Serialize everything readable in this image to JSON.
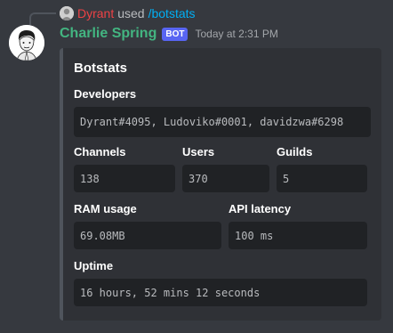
{
  "interaction": {
    "user": "Dyrant",
    "used_word": "used",
    "command": "/botstats"
  },
  "message": {
    "author": "Charlie Spring",
    "badge": "BOT",
    "timestamp": "Today at 2:31 PM"
  },
  "embed": {
    "title": "Botstats",
    "developers": {
      "label": "Developers",
      "value": "Dyrant#4095, Ludoviko#0001, davidzwa#6298"
    },
    "channels": {
      "label": "Channels",
      "value": "138"
    },
    "users": {
      "label": "Users",
      "value": "370"
    },
    "guilds": {
      "label": "Guilds",
      "value": "5"
    },
    "ram": {
      "label": "RAM usage",
      "value": "69.08MB"
    },
    "latency": {
      "label": "API latency",
      "value": "100 ms"
    },
    "uptime": {
      "label": "Uptime",
      "value": "16 hours, 52 mins 12 seconds"
    }
  },
  "colors": {
    "background": "#36393f",
    "embed_background": "#2f3136",
    "code_background": "#202225",
    "author_color": "#43b581",
    "interaction_user_color": "#ed4245",
    "command_color": "#00aff4",
    "badge_color": "#5865f2"
  }
}
